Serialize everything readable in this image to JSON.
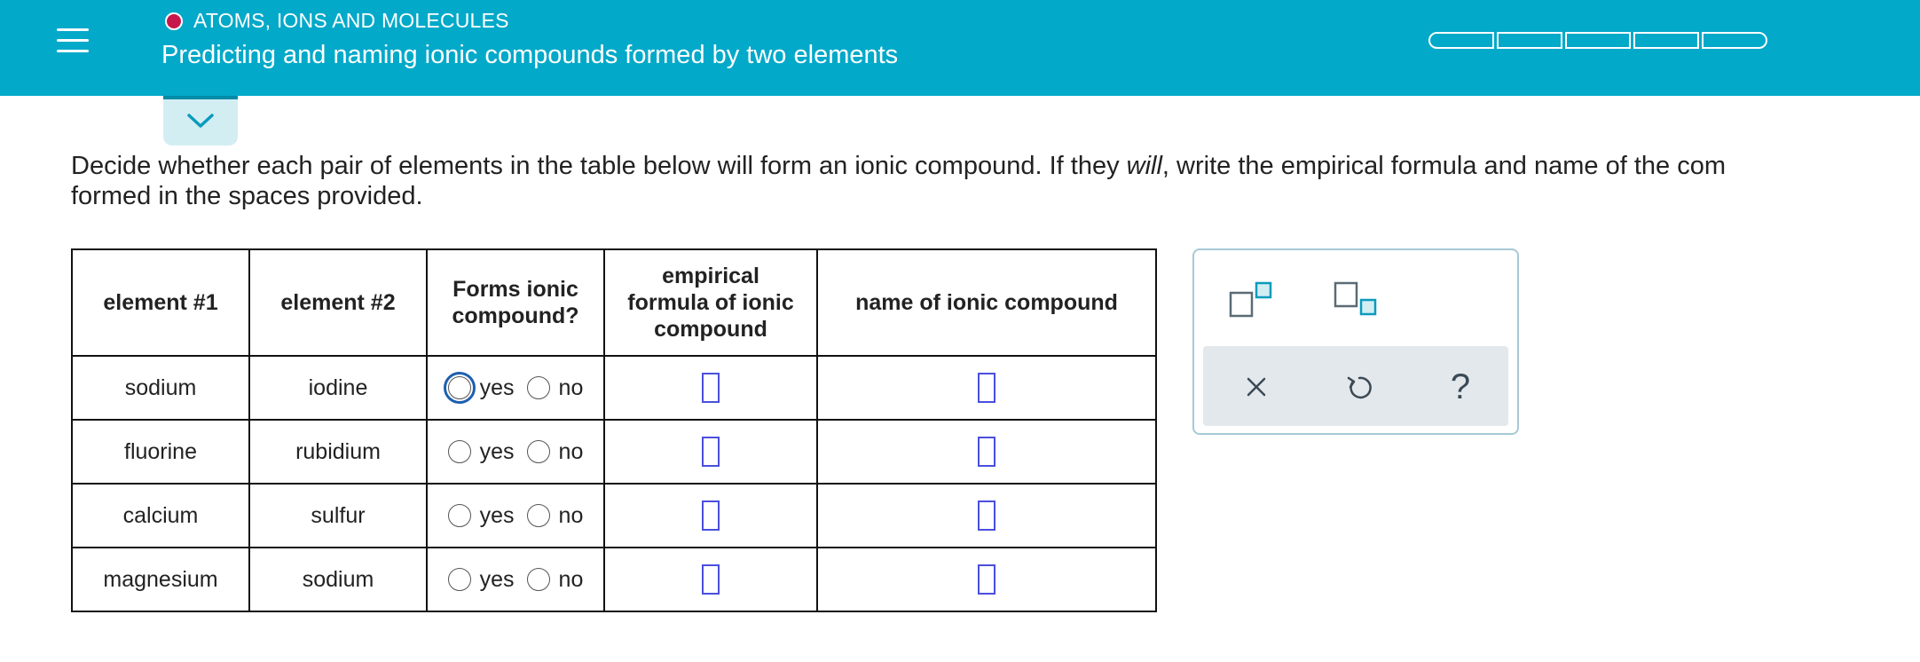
{
  "header": {
    "topic": "ATOMS, IONS AND MOLECULES",
    "title": "Predicting and naming ionic compounds formed by two elements",
    "topic_color": "#c8174b",
    "bar_color": "#03a9c9",
    "progress_segments": 5
  },
  "prompt": {
    "part1": "Decide whether each pair of elements in the table below will form an ionic compound. If they ",
    "emphasis": "will",
    "part2": ", write the empirical formula and name of the com",
    "line2": "formed in the spaces provided."
  },
  "table": {
    "headers": {
      "el1": "element #1",
      "el2": "element #2",
      "forms_a": "Forms ionic",
      "forms_b": "compound?",
      "formula_a": "empirical",
      "formula_b": "formula of ionic",
      "formula_c": "compound",
      "name": "name of ionic compound"
    },
    "yes_label": "yes",
    "no_label": "no",
    "rows": [
      {
        "el1": "sodium",
        "el2": "iodine"
      },
      {
        "el1": "fluorine",
        "el2": "rubidium"
      },
      {
        "el1": "calcium",
        "el2": "sulfur"
      },
      {
        "el1": "magnesium",
        "el2": "sodium"
      }
    ]
  },
  "tools": {
    "superscript": "superscript-icon",
    "subscript": "subscript-icon",
    "clear": "×",
    "undo": "undo-icon",
    "help": "?"
  }
}
